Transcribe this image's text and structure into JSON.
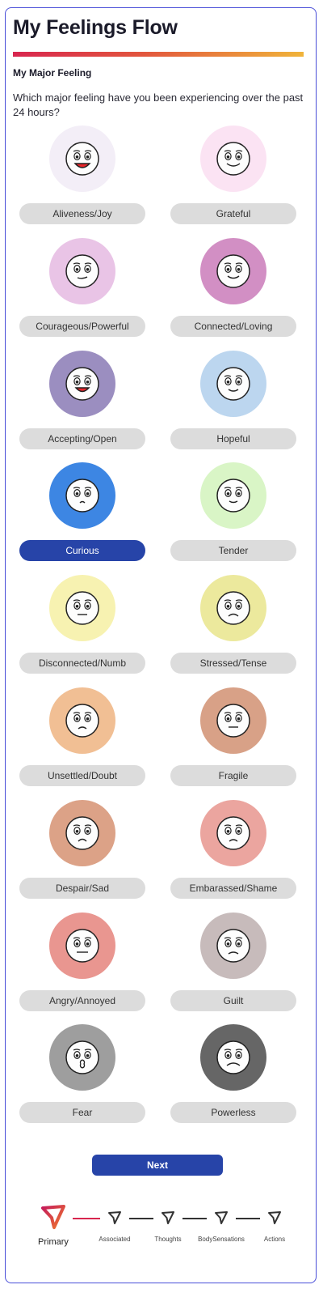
{
  "header": {
    "title": "My Feelings Flow",
    "section_label": "My Major Feeling",
    "question": "Which major feeling have you been experiencing over the past 24 hours?"
  },
  "feelings": [
    {
      "label": "Aliveness/Joy",
      "bg": "#f3eef7",
      "selected": false
    },
    {
      "label": "Grateful",
      "bg": "#fbe3f3",
      "selected": false
    },
    {
      "label": "Courageous/Powerful",
      "bg": "#e9c4e6",
      "selected": false
    },
    {
      "label": "Connected/Loving",
      "bg": "#d28fc4",
      "selected": false
    },
    {
      "label": "Accepting/Open",
      "bg": "#9b8ec0",
      "selected": false
    },
    {
      "label": "Hopeful",
      "bg": "#bcd6ef",
      "selected": false
    },
    {
      "label": "Curious",
      "bg": "#3d86e3",
      "selected": true
    },
    {
      "label": "Tender",
      "bg": "#d9f5c6",
      "selected": false
    },
    {
      "label": "Disconnected/Numb",
      "bg": "#f7f2b1",
      "selected": false
    },
    {
      "label": "Stressed/Tense",
      "bg": "#ece99d",
      "selected": false
    },
    {
      "label": "Unsettled/Doubt",
      "bg": "#f1bf94",
      "selected": false
    },
    {
      "label": "Fragile",
      "bg": "#d8a187",
      "selected": false
    },
    {
      "label": "Despair/Sad",
      "bg": "#dca287",
      "selected": false
    },
    {
      "label": "Embarassed/Shame",
      "bg": "#eba59f",
      "selected": false
    },
    {
      "label": "Angry/Annoyed",
      "bg": "#e99690",
      "selected": false
    },
    {
      "label": "Guilt",
      "bg": "#c7bbbb",
      "selected": false
    },
    {
      "label": "Fear",
      "bg": "#9e9e9e",
      "selected": false
    },
    {
      "label": "Powerless",
      "bg": "#666666",
      "selected": false
    }
  ],
  "actions": {
    "next_label": "Next"
  },
  "stepper": {
    "steps": [
      {
        "label": "Primary",
        "active": true
      },
      {
        "label": "Associated",
        "active": false
      },
      {
        "label": "Thoughts",
        "active": false
      },
      {
        "label": "BodySensations",
        "active": false
      },
      {
        "label": "Actions",
        "active": false
      }
    ]
  },
  "colors": {
    "accent": "#2744a8",
    "frame": "#4a4fd8",
    "pill_bg": "#dcdcdc",
    "gradient_start": "#d8264f",
    "gradient_end": "#f0b43a"
  }
}
